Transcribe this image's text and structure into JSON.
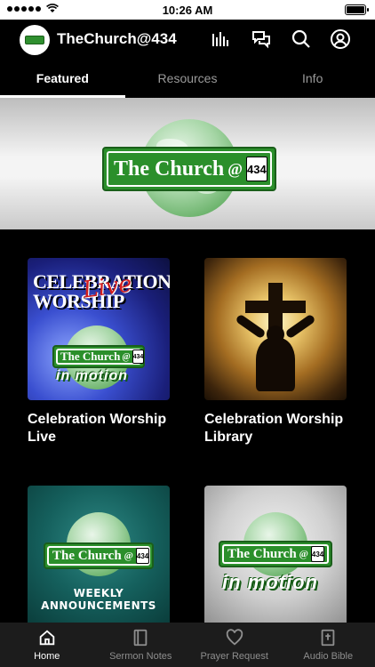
{
  "status_bar": {
    "time": "10:26 AM",
    "battery_level": 1.0
  },
  "header": {
    "app_title": "TheChurch@434",
    "icons": [
      "equalizer-icon",
      "chat-bubbles-icon",
      "search-icon",
      "account-icon"
    ]
  },
  "tabs": [
    {
      "label": "Featured",
      "active": true
    },
    {
      "label": "Resources",
      "active": false
    },
    {
      "label": "Info",
      "active": false
    }
  ],
  "hero": {
    "logo_text": "The Church",
    "logo_at": "@",
    "logo_number": "434"
  },
  "cards": [
    {
      "title": "Celebration Worship Live",
      "art": {
        "headline": "CELEBRATION WORSHIP",
        "script": "Live",
        "logo_text": "The Church",
        "logo_at": "@",
        "logo_number": "434",
        "motion": "in motion"
      }
    },
    {
      "title": "Celebration Worship Library"
    },
    {
      "title": "",
      "art": {
        "logo_text": "The Church",
        "logo_at": "@",
        "logo_number": "434",
        "banner": "WEEKLY ANNOUNCEMENTS"
      }
    },
    {
      "title": "",
      "art": {
        "logo_text": "The Church",
        "logo_at": "@",
        "logo_number": "434",
        "motion": "in motion"
      }
    }
  ],
  "bottom_nav": [
    {
      "label": "Home",
      "icon": "home-icon",
      "active": true
    },
    {
      "label": "Sermon Notes",
      "icon": "notebook-icon",
      "active": false
    },
    {
      "label": "Prayer Request",
      "icon": "heart-icon",
      "active": false
    },
    {
      "label": "Audio Bible",
      "icon": "bible-icon",
      "active": false
    }
  ],
  "colors": {
    "background": "#000000",
    "brand_green": "#2b8f2b",
    "nav_bg": "#1c1c1c",
    "inactive_text": "#9a9a9a"
  }
}
